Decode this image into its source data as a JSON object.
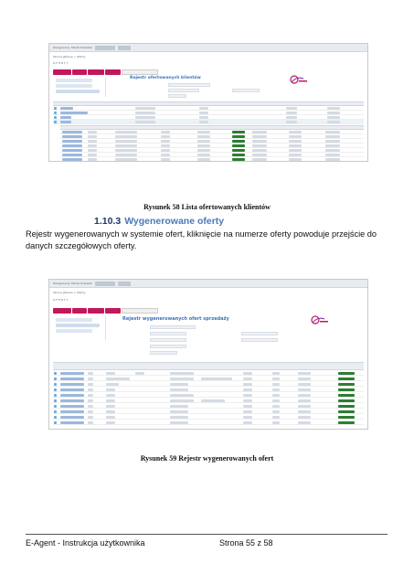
{
  "figure1": {
    "caption": "Rysunek 58 Lista ofertowanych klientów",
    "window_title": "Zalogowany: Marek Kowalski",
    "breadcrumb": "Strona główna > Oferty",
    "panel_title": "Rejestr ofertowanych klientów",
    "crumbs_label": "OFERTY",
    "left_items": [
      "Oferowani klienci",
      "Wygenerowane oferty",
      "Nowa oferta Telco"
    ],
    "rows_upper": 4,
    "rows_lower": 10
  },
  "section": {
    "number": "1.10.3",
    "title": "Wygenerowane oferty"
  },
  "paragraph": "Rejestr wygenerowanych w systemie ofert, kliknięcie na numerze oferty powoduje przejście do danych szczegółowych oferty.",
  "figure2": {
    "caption": "Rysunek 59 Rejestr wygenerowanych ofert",
    "window_title": "Zalogowany: Marek Kowalski",
    "breadcrumb": "Strona główna > Oferty",
    "panel_title": "Rejestr wygenerowanych ofert sprzedaży",
    "crumbs_label": "OFERTY",
    "left_items": [
      "Oferowani klienci",
      "Wygenerowane oferty",
      "Nowa oferta Telco"
    ],
    "rows": 10
  },
  "footer": {
    "left": "E-Agent - Instrukcja użytkownika",
    "right": "Strona 55 z 58"
  },
  "colors": {
    "menu_accent": "#c2185b",
    "heading_number": "#1f3864",
    "heading_text": "#4a7ab8",
    "link_blue": "#3a73b8"
  }
}
